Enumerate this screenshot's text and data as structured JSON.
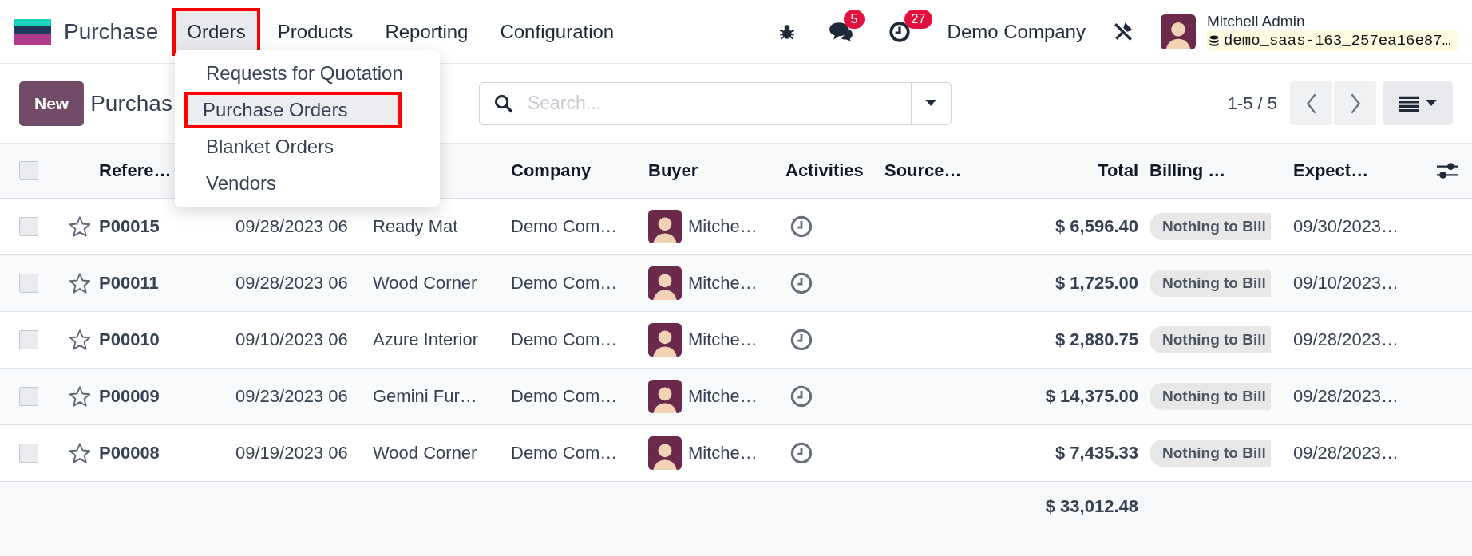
{
  "app": {
    "name": "Purchase"
  },
  "nav": [
    {
      "label": "Orders",
      "selected": true
    },
    {
      "label": "Products",
      "selected": false
    },
    {
      "label": "Reporting",
      "selected": false
    },
    {
      "label": "Configuration",
      "selected": false
    }
  ],
  "systray": {
    "messages_count": "5",
    "activities_count": "27",
    "company": "Demo Company",
    "user": {
      "name": "Mitchell Admin",
      "database": "demo_saas-163_257ea16e87…"
    }
  },
  "orders_menu": [
    {
      "label": "Requests for Quotation",
      "selected": false
    },
    {
      "label": "Purchase Orders",
      "selected": true
    },
    {
      "label": "Blanket Orders",
      "selected": false
    },
    {
      "label": "Vendors",
      "selected": false
    }
  ],
  "control_panel": {
    "new_button": "New",
    "breadcrumb": "Purchas",
    "search": {
      "placeholder": "Search..."
    },
    "pager": "1-5 / 5"
  },
  "table": {
    "select_all_checked": false,
    "headers": {
      "reference": "Refere…",
      "company": "Company",
      "buyer": "Buyer",
      "activities": "Activities",
      "source": "Source…",
      "total": "Total",
      "billing": "Billing …",
      "expected": "Expect…"
    },
    "rows": [
      {
        "checked": false,
        "starred": false,
        "reference": "P00015",
        "order_date": "09/28/2023 06",
        "vendor": "Ready Mat",
        "company": "Demo Com…",
        "buyer": "Mitche…",
        "total": "$ 6,596.40",
        "billing_status": "Nothing to Bill",
        "expected": "09/30/2023…"
      },
      {
        "checked": false,
        "starred": false,
        "reference": "P00011",
        "order_date": "09/28/2023 06",
        "vendor": "Wood Corner",
        "company": "Demo Com…",
        "buyer": "Mitche…",
        "total": "$ 1,725.00",
        "billing_status": "Nothing to Bill",
        "expected": "09/10/2023…"
      },
      {
        "checked": false,
        "starred": false,
        "reference": "P00010",
        "order_date": "09/10/2023 06",
        "vendor": "Azure Interior",
        "company": "Demo Com…",
        "buyer": "Mitche…",
        "total": "$ 2,880.75",
        "billing_status": "Nothing to Bill",
        "expected": "09/28/2023…"
      },
      {
        "checked": false,
        "starred": false,
        "reference": "P00009",
        "order_date": "09/23/2023 06",
        "vendor": "Gemini Fur…",
        "company": "Demo Com…",
        "buyer": "Mitche…",
        "total": "$ 14,375.00",
        "billing_status": "Nothing to Bill",
        "expected": "09/28/2023…"
      },
      {
        "checked": false,
        "starred": false,
        "reference": "P00008",
        "order_date": "09/19/2023 06",
        "vendor": "Wood Corner",
        "company": "Demo Com…",
        "buyer": "Mitche…",
        "total": "$ 7,435.33",
        "billing_status": "Nothing to Bill",
        "expected": "09/28/2023…"
      }
    ],
    "footer_total": "$ 33,012.48"
  }
}
